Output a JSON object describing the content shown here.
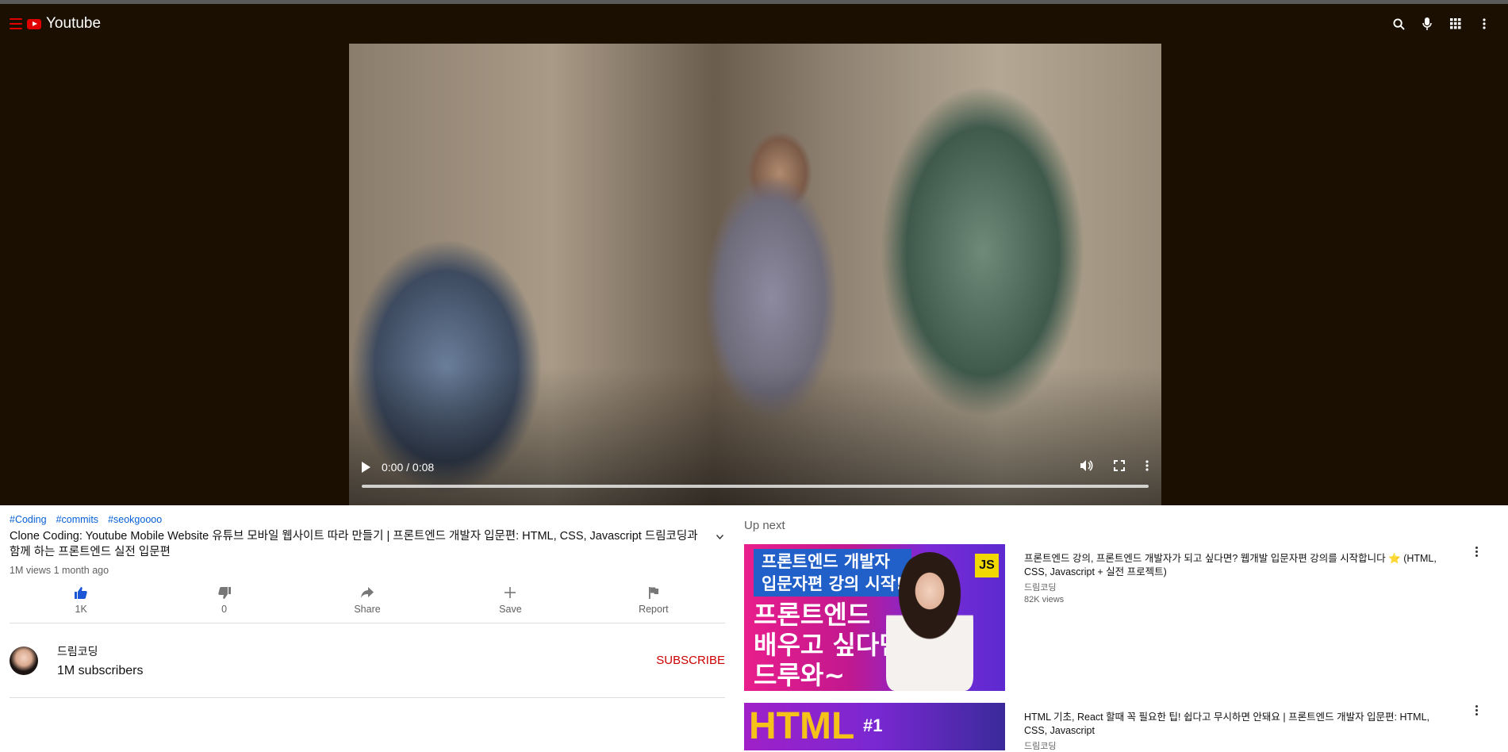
{
  "header": {
    "brand_name": "Youtube",
    "icons": [
      "menu-icon",
      "youtube-logo-icon",
      "search-icon",
      "microphone-icon",
      "apps-grid-icon",
      "more-vert-icon"
    ],
    "accent_color": "#e00000",
    "background_color": "#1a0f00"
  },
  "player": {
    "time_display": "0:00 / 0:08",
    "icons": [
      "play-icon",
      "volume-icon",
      "fullscreen-icon",
      "more-vert-icon"
    ]
  },
  "video": {
    "tags": [
      "#Coding",
      "#commits",
      "#seokgoooo"
    ],
    "title": "Clone Coding: Youtube Mobile Website 유튜브 모바일 웹사이트 따라 만들기 | 프론트엔드 개발자 입문편: HTML, CSS, Javascript 드림코딩과 함께 하는 프론트엔드 실전 입문편",
    "meta": "1M views 1 month ago"
  },
  "actions": [
    {
      "label": "1K",
      "icon": "thumbs-up-icon"
    },
    {
      "label": "0",
      "icon": "thumbs-down-icon"
    },
    {
      "label": "Share",
      "icon": "share-icon"
    },
    {
      "label": "Save",
      "icon": "plus-icon"
    },
    {
      "label": "Report",
      "icon": "flag-icon"
    }
  ],
  "channel": {
    "name": "드림코딩",
    "subscribers": "1M subscribers",
    "subscribe_label": "SUBSCRIBE"
  },
  "upnext": {
    "title": "Up next",
    "items": [
      {
        "title": "프론트엔드 강의, 프론트엔드 개발자가 되고 싶다면? 웹개발 입문자편 강의를 시작합니다 ⭐ (HTML, CSS, Javascript + 실전 프로젝트)",
        "channel": "드림코딩",
        "views": "82K views",
        "thumb_line1": "프론트엔드 개발자",
        "thumb_line1b": "입문자편 강의 시작!",
        "thumb_line2": "프론트엔드",
        "thumb_line3": "배우고 싶다면",
        "thumb_line4": "드루와~",
        "thumb_badge": "JS"
      },
      {
        "title": "HTML 기초, React 할때 꼭 필요한 팁! 쉽다고 무시하면 안돼요 | 프론트엔드 개발자 입문편: HTML, CSS, Javascript",
        "channel": "드림코딩",
        "thumb_main": "HTML",
        "thumb_num": "#1"
      }
    ]
  }
}
